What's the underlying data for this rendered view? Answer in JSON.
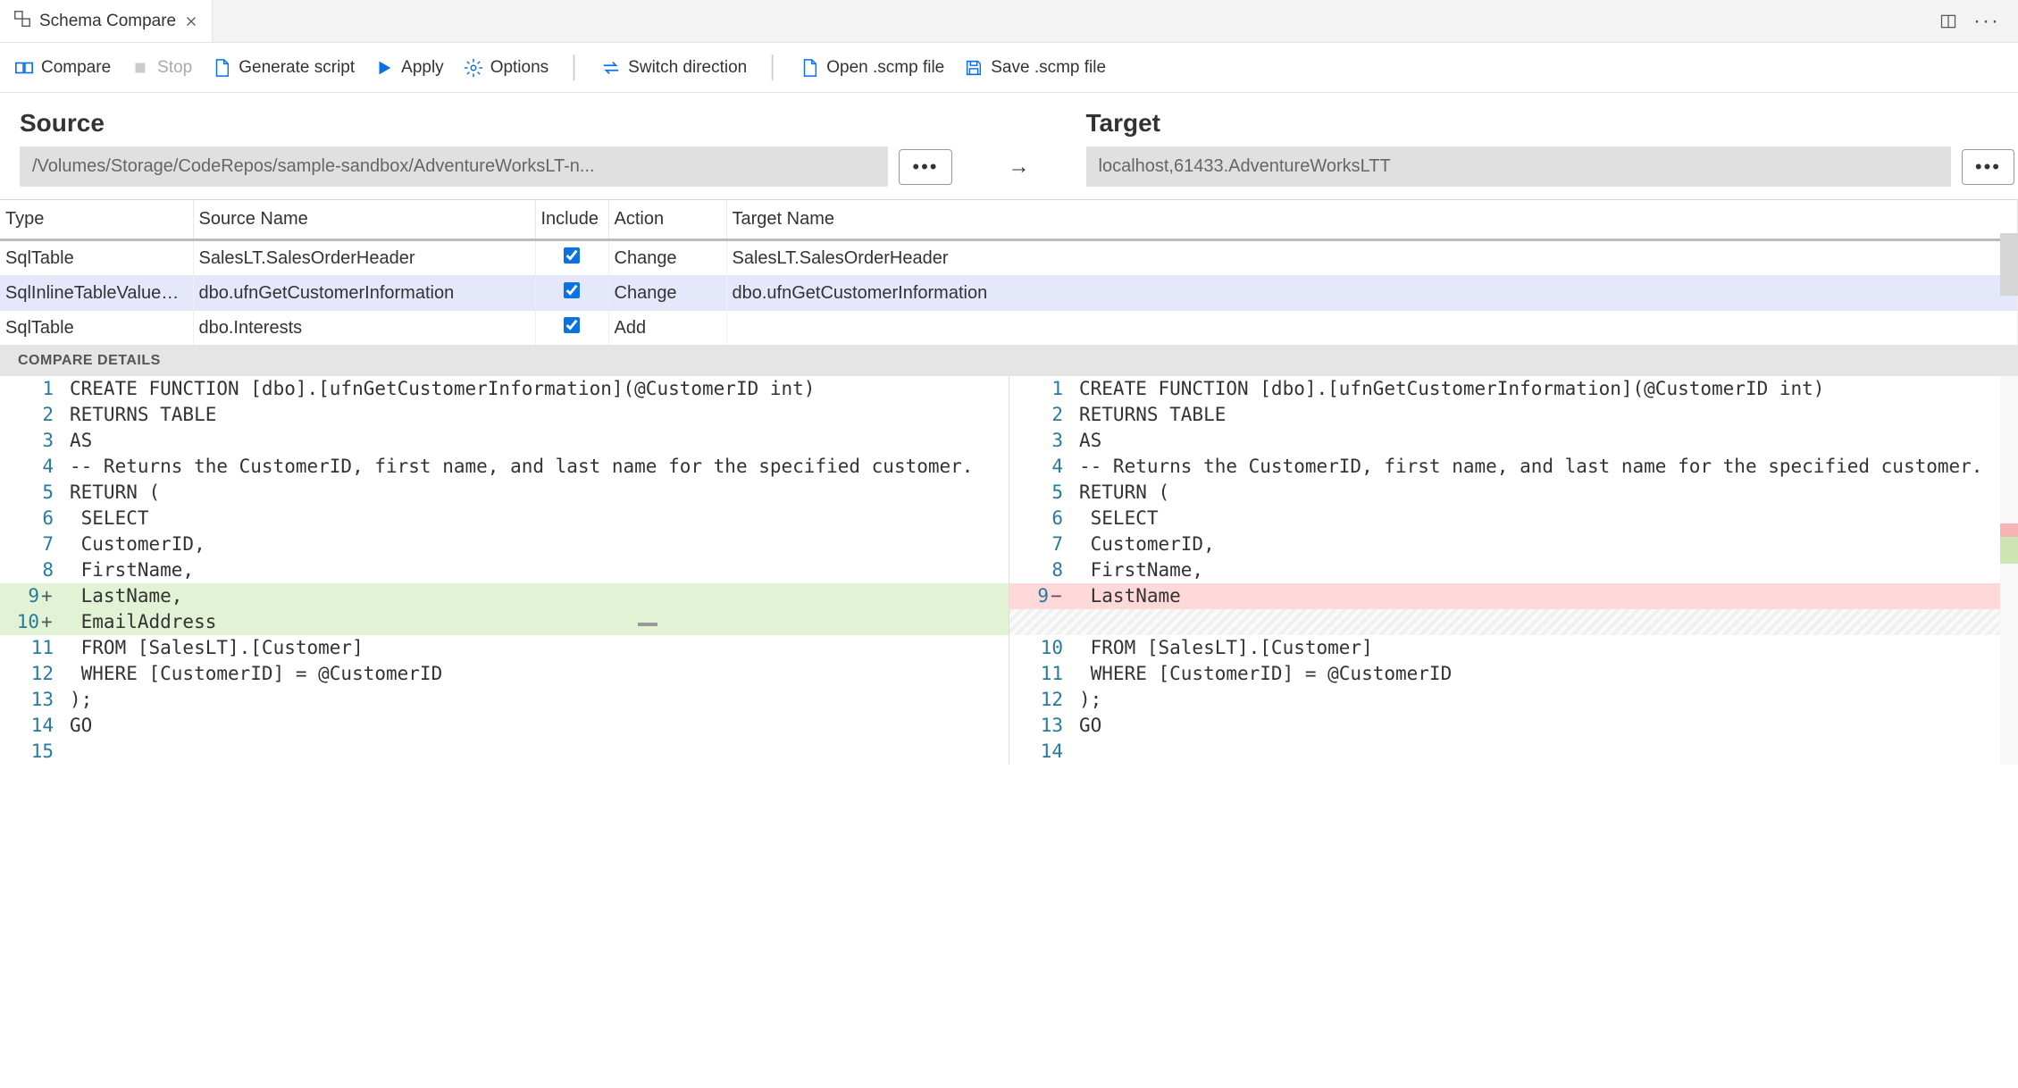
{
  "tab": {
    "title": "Schema Compare"
  },
  "toolbar": {
    "compare": "Compare",
    "stop": "Stop",
    "generate": "Generate script",
    "apply": "Apply",
    "options": "Options",
    "switch": "Switch direction",
    "open": "Open .scmp file",
    "save": "Save .scmp file"
  },
  "source": {
    "heading": "Source",
    "path": "/Volumes/Storage/CodeRepos/sample-sandbox/AdventureWorksLT-n..."
  },
  "target": {
    "heading": "Target",
    "path": "localhost,61433.AdventureWorksLTT"
  },
  "arrow": "→",
  "columns": {
    "type": "Type",
    "sourceName": "Source Name",
    "include": "Include",
    "action": "Action",
    "targetName": "Target Name"
  },
  "rows": [
    {
      "type": "SqlTable",
      "src": "SalesLT.SalesOrderHeader",
      "include": true,
      "action": "Change",
      "target": "SalesLT.SalesOrderHeader",
      "selected": false
    },
    {
      "type": "SqlInlineTableValuedFu...",
      "src": "dbo.ufnGetCustomerInformation",
      "include": true,
      "action": "Change",
      "target": "dbo.ufnGetCustomerInformation",
      "selected": true
    },
    {
      "type": "SqlTable",
      "src": "dbo.Interests",
      "include": true,
      "action": "Add",
      "target": "",
      "selected": false
    }
  ],
  "details_header": "COMPARE DETAILS",
  "left_code": [
    {
      "n": 1,
      "t": "CREATE FUNCTION [dbo].[ufnGetCustomerInformation](@CustomerID int)",
      "state": ""
    },
    {
      "n": 2,
      "t": "RETURNS TABLE",
      "state": ""
    },
    {
      "n": 3,
      "t": "AS",
      "state": ""
    },
    {
      "n": 4,
      "t": "-- Returns the CustomerID, first name, and last name for the specified customer.",
      "state": ""
    },
    {
      "n": 5,
      "t": "RETURN (",
      "state": ""
    },
    {
      "n": 6,
      "t": " SELECT",
      "state": ""
    },
    {
      "n": 7,
      "t": " CustomerID,",
      "state": ""
    },
    {
      "n": 8,
      "t": " FirstName,",
      "state": ""
    },
    {
      "n": 9,
      "t": " LastName,",
      "state": "added"
    },
    {
      "n": 10,
      "t": " EmailAddress",
      "state": "added"
    },
    {
      "n": 11,
      "t": " FROM [SalesLT].[Customer]",
      "state": ""
    },
    {
      "n": 12,
      "t": " WHERE [CustomerID] = @CustomerID",
      "state": ""
    },
    {
      "n": 13,
      "t": ");",
      "state": ""
    },
    {
      "n": 14,
      "t": "GO",
      "state": ""
    },
    {
      "n": 15,
      "t": "",
      "state": ""
    }
  ],
  "right_code": [
    {
      "n": 1,
      "t": "CREATE FUNCTION [dbo].[ufnGetCustomerInformation](@CustomerID int)",
      "state": ""
    },
    {
      "n": 2,
      "t": "RETURNS TABLE",
      "state": ""
    },
    {
      "n": 3,
      "t": "AS",
      "state": ""
    },
    {
      "n": 4,
      "t": "-- Returns the CustomerID, first name, and last name for the specified customer.",
      "state": ""
    },
    {
      "n": 5,
      "t": "RETURN (",
      "state": ""
    },
    {
      "n": 6,
      "t": " SELECT",
      "state": ""
    },
    {
      "n": 7,
      "t": " CustomerID,",
      "state": ""
    },
    {
      "n": 8,
      "t": " FirstName,",
      "state": ""
    },
    {
      "n": 9,
      "t": " LastName",
      "state": "removed"
    },
    {
      "n": "",
      "t": "",
      "state": "empty"
    },
    {
      "n": 10,
      "t": " FROM [SalesLT].[Customer]",
      "state": ""
    },
    {
      "n": 11,
      "t": " WHERE [CustomerID] = @CustomerID",
      "state": ""
    },
    {
      "n": 12,
      "t": ");",
      "state": ""
    },
    {
      "n": 13,
      "t": "GO",
      "state": ""
    },
    {
      "n": 14,
      "t": "",
      "state": ""
    }
  ]
}
